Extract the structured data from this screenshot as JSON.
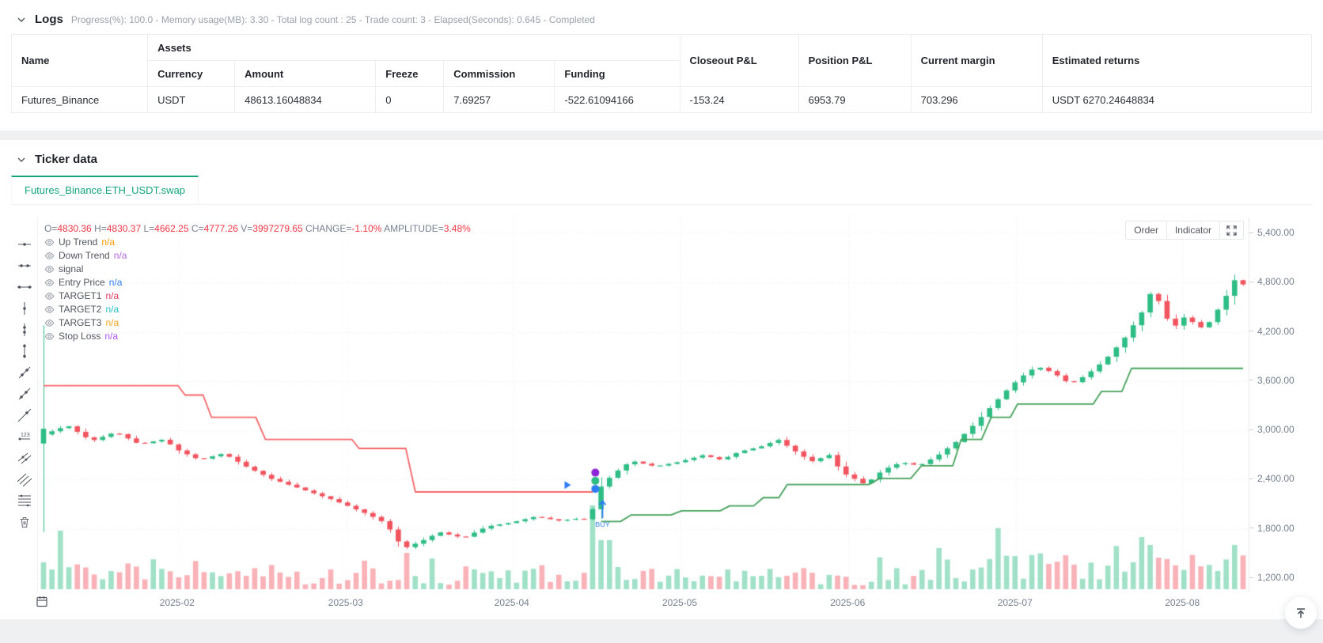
{
  "theme": {
    "accent_green": "#14a57c",
    "value_red": "#f23645",
    "text_gray": "#76808f",
    "candle_up": "#2dbd85",
    "candle_down": "#f2545f"
  },
  "logs": {
    "title": "Logs",
    "meta": "Progress(%): 100.0  - Memory usage(MB): 3.30 - Total log count : 25 - Trade count:  3 - Elapsed(Seconds): 0.645 - Completed"
  },
  "assets_table": {
    "headers": {
      "name": "Name",
      "assets": "Assets",
      "currency": "Currency",
      "amount": "Amount",
      "freeze": "Freeze",
      "commission": "Commission",
      "funding": "Funding",
      "closeout_pnl": "Closeout P&L",
      "position_pnl": "Position P&L",
      "current_margin": "Current margin",
      "estimated_returns": "Estimated returns"
    },
    "row": {
      "name": "Futures_Binance",
      "currency": "USDT",
      "amount": "48613.16048834",
      "freeze": "0",
      "commission": "7.69257",
      "funding": "-522.61094166",
      "closeout_pnl": "-153.24",
      "position_pnl": "6953.79",
      "current_margin": "703.296",
      "estimated_returns": "USDT 6270.24648834"
    }
  },
  "ticker": {
    "title": "Ticker data",
    "tab": "Futures_Binance.ETH_USDT.swap"
  },
  "chart_toolbar": {
    "order": "Order",
    "indicator": "Indicator"
  },
  "chart_data": {
    "type": "candlestick",
    "symbol": "Futures_Binance.ETH_USDT.swap",
    "ohlc_items": [
      {
        "label": "O=",
        "value": "4830.36"
      },
      {
        "label": "H=",
        "value": "4830.37"
      },
      {
        "label": "L=",
        "value": "4662.25"
      },
      {
        "label": "C=",
        "value": "4777.26"
      },
      {
        "label": "V=",
        "value": "3997279.65"
      },
      {
        "label": "CHANGE=",
        "value": "-1.10%"
      },
      {
        "label": "AMPLITUDE=",
        "value": "3.48%"
      }
    ],
    "legend": [
      {
        "label": "Up Trend",
        "value": "n/a",
        "color": "#ff9900"
      },
      {
        "label": "Down Trend",
        "value": "n/a",
        "color": "#b36ae2"
      },
      {
        "label": "signal",
        "value": "",
        "color": ""
      },
      {
        "label": "Entry Price",
        "value": "n/a",
        "color": "#2f7df6"
      },
      {
        "label": "TARGET1",
        "value": "n/a",
        "color": "#e23a5f"
      },
      {
        "label": "TARGET2",
        "value": "n/a",
        "color": "#26c1c9"
      },
      {
        "label": "TARGET3",
        "value": "n/a",
        "color": "#f5a623"
      },
      {
        "label": "Stop Loss",
        "value": "n/a",
        "color": "#a855f7"
      }
    ],
    "y_axis": {
      "min": 1200,
      "max": 5400,
      "ticks": [
        {
          "price": 5400,
          "label": "5,400.00"
        },
        {
          "price": 4800,
          "label": "4,800.00"
        },
        {
          "price": 4200,
          "label": "4,200.00"
        },
        {
          "price": 3600,
          "label": "3,600.00"
        },
        {
          "price": 3000,
          "label": "3,000.00"
        },
        {
          "price": 2400,
          "label": "2,400.00"
        },
        {
          "price": 1800,
          "label": "1,800.00"
        },
        {
          "price": 1200,
          "label": "1,200.00"
        }
      ]
    },
    "x_axis": {
      "ticks": [
        {
          "t": 0.112,
          "label": "2025-02"
        },
        {
          "t": 0.2525,
          "label": "2025-03"
        },
        {
          "t": 0.391,
          "label": "2025-04"
        },
        {
          "t": 0.531,
          "label": "2025-05"
        },
        {
          "t": 0.671,
          "label": "2025-06"
        },
        {
          "t": 0.8105,
          "label": "2025-07"
        },
        {
          "t": 0.95,
          "label": "2025-08"
        }
      ]
    },
    "bar_count": 143,
    "first_bar": {
      "open": 2840,
      "close": 3020,
      "high": 4280,
      "low": 1760
    },
    "close_anchors": [
      [
        0,
        2950
      ],
      [
        0.02,
        3060
      ],
      [
        0.04,
        2870
      ],
      [
        0.06,
        2980
      ],
      [
        0.08,
        2830
      ],
      [
        0.1,
        2890
      ],
      [
        0.112,
        2760
      ],
      [
        0.13,
        2640
      ],
      [
        0.15,
        2720
      ],
      [
        0.17,
        2550
      ],
      [
        0.19,
        2410
      ],
      [
        0.22,
        2260
      ],
      [
        0.24,
        2160
      ],
      [
        0.252,
        2090
      ],
      [
        0.27,
        1980
      ],
      [
        0.285,
        1870
      ],
      [
        0.3,
        1560
      ],
      [
        0.315,
        1650
      ],
      [
        0.33,
        1760
      ],
      [
        0.35,
        1690
      ],
      [
        0.37,
        1830
      ],
      [
        0.391,
        1880
      ],
      [
        0.41,
        1950
      ],
      [
        0.43,
        1900
      ],
      [
        0.448,
        1930
      ],
      [
        0.455,
        1900
      ],
      [
        0.4625,
        2280
      ],
      [
        0.475,
        2470
      ],
      [
        0.49,
        2630
      ],
      [
        0.51,
        2560
      ],
      [
        0.531,
        2620
      ],
      [
        0.55,
        2700
      ],
      [
        0.565,
        2640
      ],
      [
        0.58,
        2740
      ],
      [
        0.6,
        2810
      ],
      [
        0.612,
        2890
      ],
      [
        0.625,
        2760
      ],
      [
        0.64,
        2620
      ],
      [
        0.655,
        2700
      ],
      [
        0.666,
        2480
      ],
      [
        0.671,
        2450
      ],
      [
        0.685,
        2340
      ],
      [
        0.7,
        2520
      ],
      [
        0.715,
        2610
      ],
      [
        0.73,
        2570
      ],
      [
        0.745,
        2690
      ],
      [
        0.76,
        2850
      ],
      [
        0.775,
        3060
      ],
      [
        0.79,
        3290
      ],
      [
        0.805,
        3520
      ],
      [
        0.814,
        3640
      ],
      [
        0.828,
        3780
      ],
      [
        0.842,
        3700
      ],
      [
        0.856,
        3560
      ],
      [
        0.87,
        3680
      ],
      [
        0.885,
        3860
      ],
      [
        0.9,
        4100
      ],
      [
        0.915,
        4420
      ],
      [
        0.925,
        4740
      ],
      [
        0.935,
        4380
      ],
      [
        0.945,
        4260
      ],
      [
        0.953,
        4420
      ],
      [
        0.962,
        4230
      ],
      [
        0.972,
        4320
      ],
      [
        0.983,
        4560
      ],
      [
        0.993,
        4830
      ],
      [
        1,
        4777.26
      ]
    ],
    "down_trend_line": {
      "name": "Down Trend stop",
      "color": "#f56468",
      "points": [
        [
          0,
          3545
        ],
        [
          0.112,
          3545
        ],
        [
          0.118,
          3430
        ],
        [
          0.133,
          3430
        ],
        [
          0.14,
          3160
        ],
        [
          0.177,
          3160
        ],
        [
          0.185,
          2890
        ],
        [
          0.257,
          2890
        ],
        [
          0.263,
          2780
        ],
        [
          0.302,
          2780
        ],
        [
          0.31,
          2250
        ],
        [
          0.458,
          2250
        ]
      ]
    },
    "up_trend_line": {
      "name": "Up Trend stop",
      "color": "#44a05a",
      "points": [
        [
          0.465,
          1890
        ],
        [
          0.481,
          1890
        ],
        [
          0.49,
          1970
        ],
        [
          0.523,
          1970
        ],
        [
          0.532,
          2020
        ],
        [
          0.564,
          2020
        ],
        [
          0.572,
          2080
        ],
        [
          0.592,
          2080
        ],
        [
          0.6,
          2180
        ],
        [
          0.613,
          2180
        ],
        [
          0.62,
          2340
        ],
        [
          0.688,
          2340
        ],
        [
          0.697,
          2415
        ],
        [
          0.723,
          2415
        ],
        [
          0.732,
          2570
        ],
        [
          0.758,
          2570
        ],
        [
          0.765,
          2890
        ],
        [
          0.782,
          2890
        ],
        [
          0.79,
          3160
        ],
        [
          0.806,
          3160
        ],
        [
          0.812,
          3320
        ],
        [
          0.875,
          3320
        ],
        [
          0.882,
          3475
        ],
        [
          0.899,
          3475
        ],
        [
          0.907,
          3755
        ],
        [
          1,
          3755
        ]
      ]
    },
    "volume": {
      "base_max": 24,
      "spikes": [
        {
          "t": 0.0,
          "h": 34
        },
        {
          "t": 0.014,
          "h": 74
        },
        {
          "t": 0.3,
          "h": 46
        },
        {
          "t": 0.46,
          "h": 106
        },
        {
          "t": 0.468,
          "h": 62
        },
        {
          "t": 0.915,
          "h": 66
        },
        {
          "t": 0.925,
          "h": 56
        },
        {
          "t": 0.99,
          "h": 56
        }
      ]
    },
    "trade_markers": {
      "dots": [
        {
          "t": 0.46,
          "price": 2485,
          "color": "#8e24d8"
        },
        {
          "t": 0.46,
          "price": 2386,
          "color": "#2dbd85"
        },
        {
          "t": 0.46,
          "price": 2287,
          "color": "#2f7df6"
        }
      ],
      "triangle": {
        "t": 0.437,
        "price": 2335,
        "color": "#2f7df6"
      },
      "buy_arrow": {
        "t": 0.466,
        "from_price": 1930,
        "to_price": 2140,
        "color": "#2f7df6",
        "label": "BUY"
      }
    }
  }
}
